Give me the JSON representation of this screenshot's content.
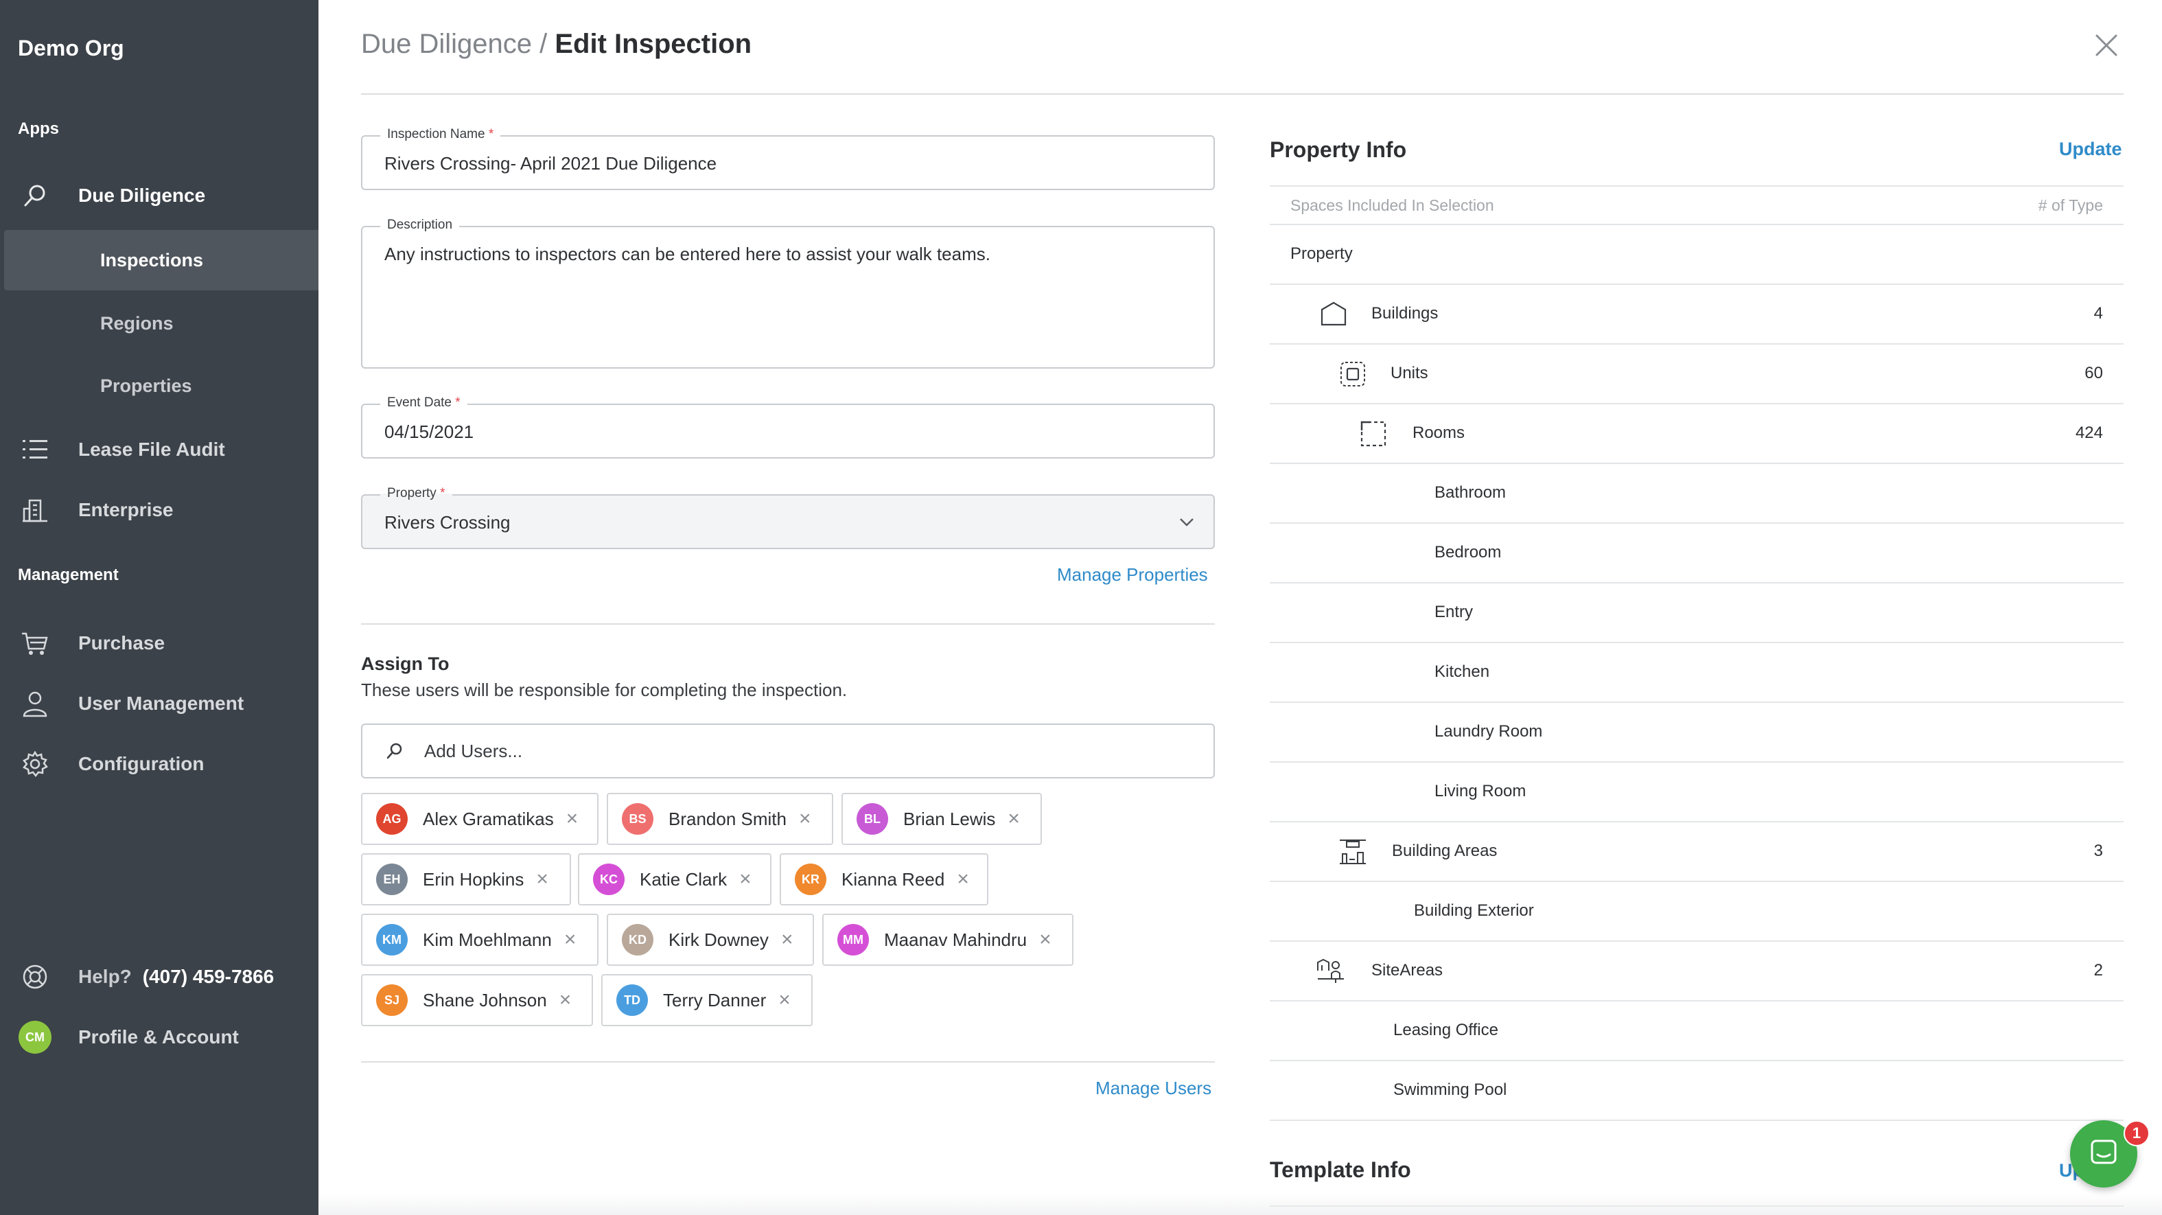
{
  "sidebar": {
    "org_name": "Demo Org",
    "apps_label": "Apps",
    "due_diligence": "Due Diligence",
    "inspections": "Inspections",
    "regions": "Regions",
    "properties": "Properties",
    "lease_file_audit": "Lease File Audit",
    "enterprise": "Enterprise",
    "management_label": "Management",
    "purchase": "Purchase",
    "user_management": "User Management",
    "configuration": "Configuration",
    "help_label": "Help?",
    "help_phone": "(407) 459-7866",
    "profile_initials": "CM",
    "profile_label": "Profile & Account"
  },
  "header": {
    "breadcrumb_parent": "Due Diligence",
    "separator": " / ",
    "breadcrumb_current": "Edit Inspection"
  },
  "form": {
    "name_label": "Inspection Name",
    "name_value": "Rivers Crossing- April 2021 Due Diligence",
    "desc_label": "Description",
    "desc_value": "Any instructions to inspectors can be entered here to assist your walk teams.",
    "date_label": "Event Date",
    "date_value": "04/15/2021",
    "property_label": "Property",
    "property_value": "Rivers Crossing",
    "required_mark": "*",
    "manage_properties": "Manage Properties"
  },
  "assign": {
    "title": "Assign To",
    "subtitle": "These users will be responsible for completing the inspection.",
    "search_placeholder": "Add Users...",
    "users": [
      {
        "initials": "AG",
        "name": "Alex Gramatikas",
        "color": "#e0452f"
      },
      {
        "initials": "BS",
        "name": "Brandon Smith",
        "color": "#ef6f6f"
      },
      {
        "initials": "BL",
        "name": "Brian Lewis",
        "color": "#c85ad6"
      },
      {
        "initials": "EH",
        "name": "Erin Hopkins",
        "color": "#7b8794"
      },
      {
        "initials": "KC",
        "name": "Katie Clark",
        "color": "#d54fd6"
      },
      {
        "initials": "KR",
        "name": "Kianna Reed",
        "color": "#f0882d"
      },
      {
        "initials": "KM",
        "name": "Kim Moehlmann",
        "color": "#4a9ee0"
      },
      {
        "initials": "KD",
        "name": "Kirk Downey",
        "color": "#b9a89a"
      },
      {
        "initials": "MM",
        "name": "Maanav Mahindru",
        "color": "#d54fd6"
      },
      {
        "initials": "SJ",
        "name": "Shane Johnson",
        "color": "#f0882d"
      },
      {
        "initials": "TD",
        "name": "Terry Danner",
        "color": "#4a9ee0"
      }
    ],
    "manage_users": "Manage Users"
  },
  "property_info": {
    "title": "Property Info",
    "update": "Update",
    "col_spaces": "Spaces Included In Selection",
    "col_count": "# of Type",
    "rows": [
      {
        "label": "Property",
        "count": ""
      },
      {
        "label": "Buildings",
        "count": "4"
      },
      {
        "label": "Units",
        "count": "60"
      },
      {
        "label": "Rooms",
        "count": "424"
      },
      {
        "label": "Bathroom",
        "count": ""
      },
      {
        "label": "Bedroom",
        "count": ""
      },
      {
        "label": "Entry",
        "count": ""
      },
      {
        "label": "Kitchen",
        "count": ""
      },
      {
        "label": "Laundry Room",
        "count": ""
      },
      {
        "label": "Living Room",
        "count": ""
      },
      {
        "label": "Building Areas",
        "count": "3"
      },
      {
        "label": "Building Exterior",
        "count": ""
      },
      {
        "label": "SiteAreas",
        "count": "2"
      },
      {
        "label": "Leasing Office",
        "count": ""
      },
      {
        "label": "Swimming Pool",
        "count": ""
      }
    ]
  },
  "template_info": {
    "title": "Template Info",
    "update": "Update"
  },
  "chat": {
    "badge": "1"
  },
  "icons": {
    "due_diligence": "search-icon",
    "lease_file_audit": "list-icon",
    "enterprise": "building-icon",
    "purchase": "cart-icon",
    "user_management": "user-icon",
    "configuration": "gear-icon",
    "help": "lifebuoy-icon",
    "close": "close-icon",
    "chat": "chat-icon"
  }
}
